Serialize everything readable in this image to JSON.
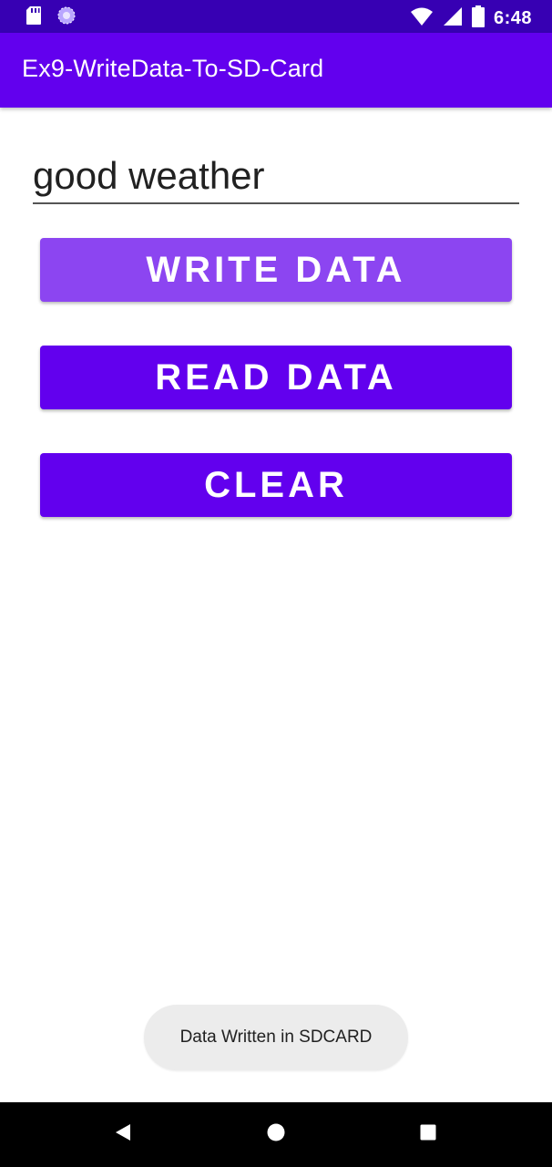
{
  "status_bar": {
    "time": "6:48",
    "left_icons": [
      "sd-card-icon",
      "sync-spinner-icon"
    ],
    "right_icons": [
      "wifi-icon",
      "cell-signal-icon",
      "battery-icon"
    ]
  },
  "app_bar": {
    "title": "Ex9-WriteData-To-SD-Card"
  },
  "input": {
    "value": "good weather"
  },
  "buttons": {
    "write_label": "WRITE DATA",
    "read_label": "READ DATA",
    "clear_label": "CLEAR"
  },
  "toast": {
    "message": "Data Written in SDCARD"
  },
  "nav_bar": {
    "icons": [
      "back-icon",
      "home-icon",
      "recents-icon"
    ]
  },
  "colors": {
    "status_bar": "#3700b3",
    "primary": "#6200ee",
    "pressed_button": "#8c45f1",
    "toast_bg": "#ececec"
  }
}
